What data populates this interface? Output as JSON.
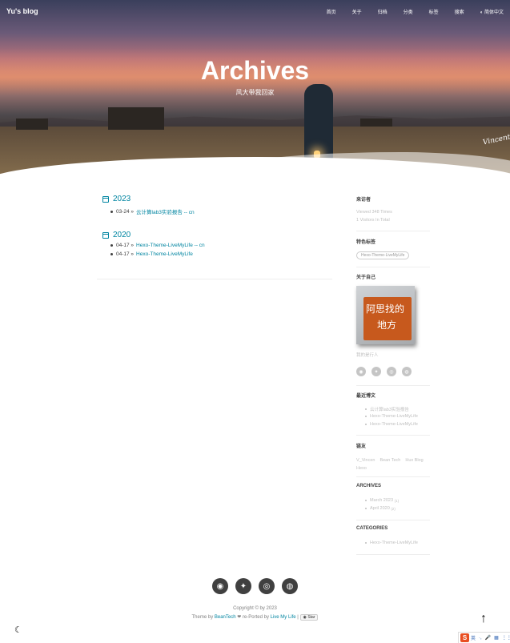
{
  "header": {
    "brand": "Yu's blog",
    "nav": [
      "首页",
      "关于",
      "归档",
      "分类",
      "标签",
      "搜索",
      "简体中文"
    ],
    "title": "Archives",
    "subtitle": "风大带我回家",
    "signature": "Vincent"
  },
  "archives": [
    {
      "year": "2023",
      "posts": [
        {
          "date": "03-24",
          "title": "云计算lab3实验报告 -- cn"
        }
      ]
    },
    {
      "year": "2020",
      "posts": [
        {
          "date": "04-17",
          "title": "Hexo-Theme-LiveMyLife -- cn"
        },
        {
          "date": "04-17",
          "title": "Hexo-Theme-LiveMyLife"
        }
      ]
    }
  ],
  "sidebar": {
    "visitors_heading": "来访者",
    "viewed": "Viewed 348 Times",
    "visitors": "1 Visitors In Total",
    "tags_heading": "特色标签",
    "tag": "Hexo-Theme-LiveMyLife",
    "about_heading": "关于自己",
    "photo_text": [
      "阿思找的",
      "地方"
    ],
    "about_text": "我的是行人",
    "social": [
      "github-icon",
      "twitter-icon",
      "instagram-icon",
      "weibo-icon"
    ],
    "recent_heading": "最近博文",
    "recent": [
      "云计算lab3实验报告",
      "Hexo-Theme-LiveMyLife",
      "Hexo-Theme-LiveMyLife"
    ],
    "friends_heading": "链友",
    "friends": [
      "V_Vincen",
      "Bean Tech",
      "Hux Blog",
      "Hexo"
    ],
    "archives_heading": "ARCHIVES",
    "archive_months": [
      {
        "label": "March 2023",
        "count": "(1)"
      },
      {
        "label": "April 2020",
        "count": "(2)"
      }
    ],
    "categories_heading": "CATEGORIES",
    "categories": [
      "Hexo-Theme-LiveMyLife"
    ]
  },
  "footer": {
    "social": [
      "github-icon",
      "twitter-icon",
      "instagram-icon",
      "weibo-icon"
    ],
    "copyright": "Copyright © by 2023",
    "theme_by": "Theme by",
    "beantech": "BeanTech",
    "reported": "re-Ported by",
    "livemylife": "Live My Life",
    "star": "Star"
  },
  "ime": {
    "label_1": "英",
    "label_2": "·,"
  }
}
